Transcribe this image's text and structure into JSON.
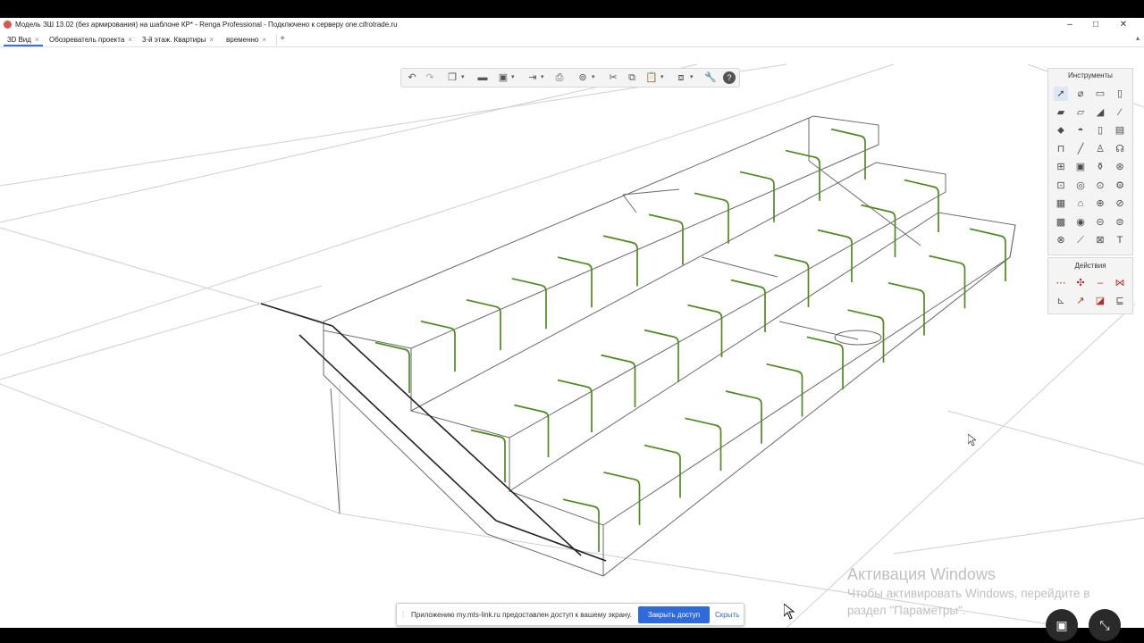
{
  "window": {
    "title": "Модель ЗШ 13.02 (без армирования) на шаблоне КР* - Renga Professional - Подключено к серверу one.cifrotrade.ru",
    "controls": {
      "minimize": "–",
      "maximize": "□",
      "close": "✕"
    }
  },
  "tabs": [
    {
      "label": "3D Вид",
      "close": "×"
    },
    {
      "label": "Обозреватель проекта",
      "close": "×"
    },
    {
      "label": "3-й этаж. Квартиры",
      "close": "×"
    },
    {
      "label": "временно",
      "close": "×"
    }
  ],
  "tab_add": "+",
  "toolbar": {
    "icons": [
      "undo-icon",
      "redo-icon",
      "views-icon",
      "open-folder-icon",
      "save-icon",
      "export-icon",
      "print-icon",
      "navigate-icon",
      "cut-icon",
      "copy-icon",
      "paste-icon",
      "layers-icon",
      "settings-wrench-icon",
      "help-icon"
    ]
  },
  "tools_panel": {
    "title": "Инструменты",
    "tools": [
      "select-icon",
      "axis-icon",
      "wall-icon",
      "column-icon",
      "beam-icon",
      "slab-icon",
      "roof-icon",
      "railing-icon",
      "floor-icon",
      "ramp-icon",
      "door-icon",
      "window-icon",
      "stair-icon",
      "line-icon",
      "equipment-icon",
      "pipe-icon",
      "room-icon",
      "element-icon",
      "plumbing-icon",
      "fitting-icon",
      "duct-icon",
      "rebar-icon",
      "mesh-icon",
      "foundation-icon",
      "opening-icon",
      "assembly-icon",
      "fixture-icon",
      "terminal-icon",
      "cabinet-icon",
      "light-icon",
      "lamp-icon",
      "connector-icon",
      "dimension-icon",
      "level-icon",
      "text-marker-icon",
      "text-icon"
    ],
    "text_tool_glyph": "T"
  },
  "actions_panel": {
    "title": "Действия",
    "actions": [
      "move-icon",
      "rotate-icon",
      "mirror-icon",
      "align-icon",
      "dimension-action-icon",
      "trim-icon",
      "color-icon",
      "properties-icon"
    ]
  },
  "watermark": {
    "line1": "Активация Windows",
    "line2": "Чтобы активировать Windows, перейдите в",
    "line3": "раздел \"Параметры\"."
  },
  "share_banner": {
    "grip": "⁞",
    "message": "Приложению my.mts-link.ru предоставлен доступ к вашему экрану.",
    "allow_button": "Закрыть доступ",
    "hide_link": "Скрыть"
  },
  "overlay_buttons": {
    "screen": "▣",
    "collapse": "⤡"
  },
  "colors": {
    "rebar": "#4d8a1f",
    "edge": "#555555",
    "accent": "#2f6ad9"
  }
}
